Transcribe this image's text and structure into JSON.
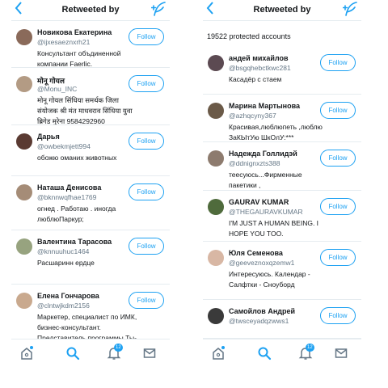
{
  "left_screen": {
    "title": "Retweeted by",
    "back_icon": "back-chevron-icon",
    "compose_icon": "compose-feather-icon",
    "users": [
      {
        "name": "Новикова Екатерина",
        "handle": "@ijxesaeznxrh21",
        "bio": "Консультант объдиненной компании Faerlic.",
        "follow_label": "Follow",
        "avatar_color": "#8a6a5a"
      },
      {
        "name": "मोनू गोयल",
        "handle": "@Monu_INC",
        "bio": "मोनू गोयल सिंधिया समर्थक जिला संयोजक श्री मंत माधवराव सिंधिया युवा ब्रिगेड मुरेना 9584292960",
        "follow_label": "Follow",
        "avatar_color": "#b39b84"
      },
      {
        "name": "Дарья",
        "handle": "@owbekmjett994",
        "bio": "обожю оманих животных",
        "follow_label": "Follow",
        "avatar_color": "#5a3a32"
      },
      {
        "name": "Наташа Денисова",
        "handle": "@bknnwqfhae1769",
        "bio": "огнед . Работаю . иногда люблюПаркур;",
        "follow_label": "Follow",
        "avatar_color": "#a58c77"
      },
      {
        "name": "Валентина Тарасова",
        "handle": "@knnuuhuc1464",
        "bio": "Расшаринн ердце",
        "follow_label": "Follow",
        "avatar_color": "#97a37f"
      },
      {
        "name": "Елена Гончарова",
        "handle": "@clntwjkdm2156",
        "bio": "Маркетер, специалист по ИМК, бизнес-консультант. Представитель программы Ты-предприниматель Астраханской",
        "follow_label": "Follow",
        "avatar_color": "#c9a98e"
      }
    ],
    "tabs": [
      {
        "icon": "home-icon",
        "has_dot": true,
        "badge": ""
      },
      {
        "icon": "search-icon",
        "active": true,
        "badge": ""
      },
      {
        "icon": "notifications-bell-icon",
        "badge": "12"
      },
      {
        "icon": "messages-envelope-icon",
        "badge": ""
      }
    ]
  },
  "right_screen": {
    "title": "Retweeted by",
    "back_icon": "back-chevron-icon",
    "compose_icon": "compose-feather-icon",
    "protected_count": "19522 protected accounts",
    "users": [
      {
        "name": "андей михайлов",
        "handle": "@bsgqhebctkwc281",
        "bio": "Касадёр с стаем",
        "follow_label": "Follow",
        "avatar_color": "#5c4a52"
      },
      {
        "name": "Марина Мартынова",
        "handle": "@azhqcyny367",
        "bio": "Красивая,люблюпеть ,люблю ЗаКЫтУю ШкОлУ:***",
        "follow_label": "Follow",
        "avatar_color": "#6b5a48"
      },
      {
        "name": "Надежда Голлидэй",
        "handle": "@ddnignxzts388",
        "bio": "теесуюсь...Фирменные пакетики ,",
        "follow_label": "Follow",
        "avatar_color": "#8d7b6e"
      },
      {
        "name": "GAURAV KUMAR",
        "handle": "@THEGAURAVKUMAR",
        "bio": "I'M JUST A HUMAN BEING. I HOPE YOU TOO.",
        "follow_label": "Follow",
        "avatar_color": "#4f6b3c"
      },
      {
        "name": "Юля Семенова",
        "handle": "@geeveznoxqzemw1",
        "bio": "Интересуюсь. Календар - Салфтки - Сноуборд",
        "follow_label": "Follow",
        "avatar_color": "#d8b7a4"
      },
      {
        "name": "Самойлов Андрей",
        "handle": "@twsceyadqzwws1",
        "bio": "",
        "follow_label": "Follow",
        "avatar_color": "#3a3a3a"
      }
    ],
    "tabs": [
      {
        "icon": "home-icon",
        "has_dot": true,
        "badge": ""
      },
      {
        "icon": "search-icon",
        "active": true,
        "badge": ""
      },
      {
        "icon": "notifications-bell-icon",
        "badge": "12"
      },
      {
        "icon": "messages-envelope-icon",
        "badge": ""
      }
    ]
  },
  "colors": {
    "accent": "#1da1f2",
    "text": "#14171a",
    "muted": "#657786",
    "divider": "#e6ecf0"
  }
}
